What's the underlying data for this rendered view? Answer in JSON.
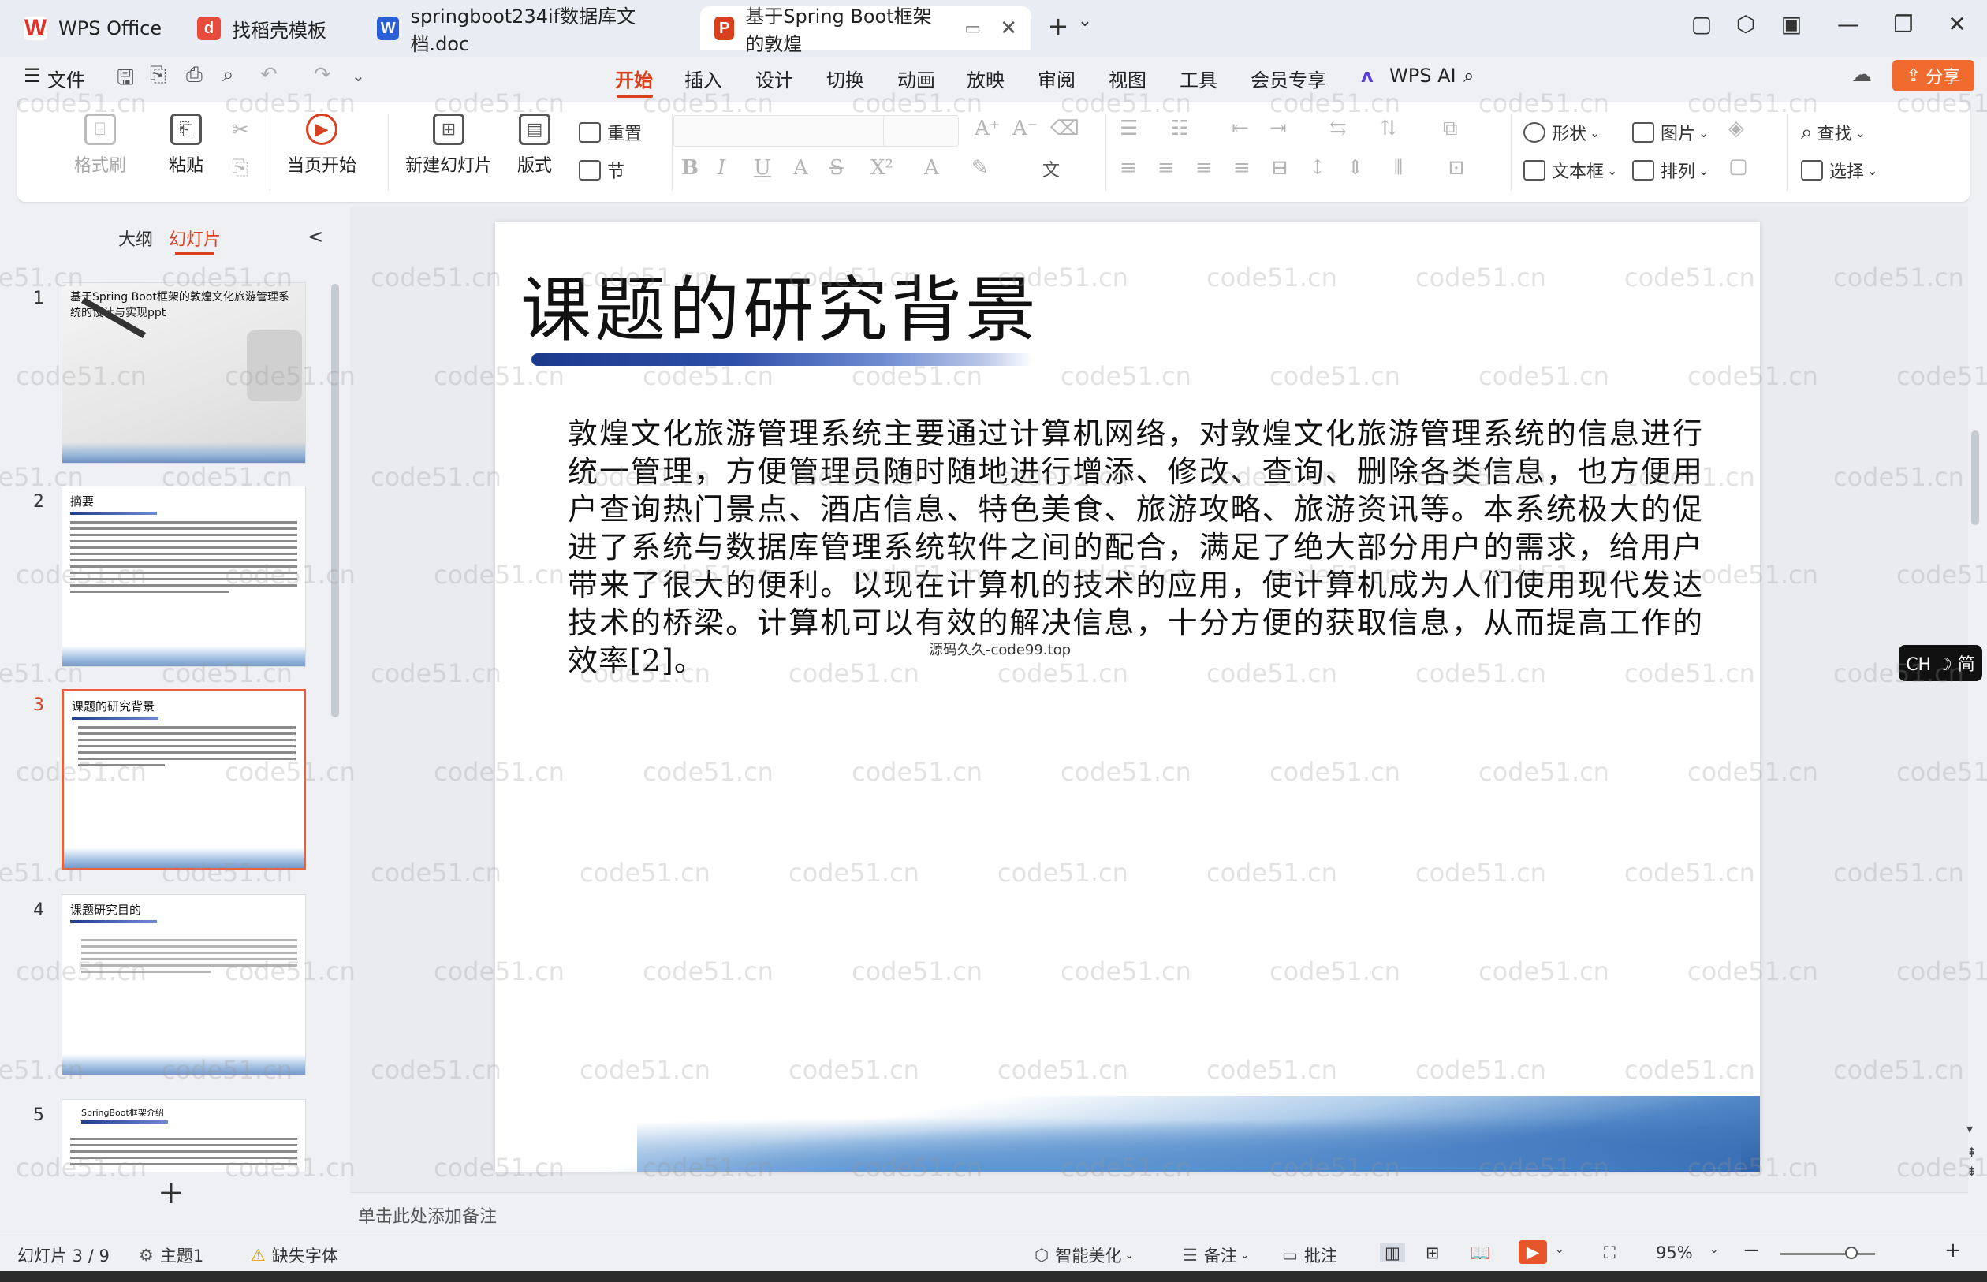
{
  "titlebar": {
    "tabs": [
      {
        "label": "WPS Office",
        "icon": "wps-logo-icon",
        "color": "#e0322b"
      },
      {
        "label": "找稻壳模板",
        "icon": "docer-logo-icon",
        "color": "#e84a3c"
      },
      {
        "label": "springboot234if数据库文档.doc",
        "icon": "word-doc-icon",
        "color": "#2b5fd9"
      },
      {
        "label": "基于Spring Boot框架的敦煌",
        "icon": "ppt-doc-icon",
        "color": "#d9411e"
      }
    ],
    "new_tab": "+",
    "tab_menu": "⌄"
  },
  "menubar": {
    "file": "文件",
    "items": [
      "开始",
      "插入",
      "设计",
      "切换",
      "动画",
      "放映",
      "审阅",
      "视图",
      "工具",
      "会员专享"
    ],
    "wps_ai": "WPS AI",
    "share": "分享"
  },
  "ribbon": {
    "format_painter": "格式刷",
    "paste": "粘贴",
    "play_current": "当页开始",
    "new_slide": "新建幻灯片",
    "layout": "版式",
    "reset": "重置",
    "section": "节",
    "shape": "形状",
    "picture": "图片",
    "textbox": "文本框",
    "arrange": "排列",
    "find": "查找",
    "select": "选择"
  },
  "leftpanel": {
    "tab_outline": "大纲",
    "tab_slides": "幻灯片",
    "collapse": "<",
    "thumbnails": [
      {
        "num": "1",
        "title": "基于Spring Boot框架的敦煌文化旅游管理系统的设计与实现ppt"
      },
      {
        "num": "2",
        "title": "摘要"
      },
      {
        "num": "3",
        "title": "课题的研究背景"
      },
      {
        "num": "4",
        "title": "课题研究目的"
      },
      {
        "num": "5",
        "title": "SpringBoot框架介绍"
      }
    ],
    "add": "+"
  },
  "slide": {
    "title": "课题的研究背景",
    "body": "敦煌文化旅游管理系统主要通过计算机网络，对敦煌文化旅游管理系统的信息进行统一管理，方便管理员随时随地进行增添、修改、查询、删除各类信息，也方便用户查询热门景点、酒店信息、特色美食、旅游攻略、旅游资讯等。本系统极大的促进了系统与数据库管理系统软件之间的配合，满足了绝大部分用户的需求，给用户带来了很大的便利。以现在计算机的技术的应用，使计算机成为人们使用现代发达技术的桥梁。计算机可以有效的解决信息，十分方便的获取信息，从而提高工作的效率[2]。",
    "caption": "源码久久-code99.top"
  },
  "notes": {
    "placeholder": "单击此处添加备注"
  },
  "statusbar": {
    "slide_counter": "幻灯片 3 / 9",
    "theme": "主题1",
    "missing_font": "缺失字体",
    "smart_beautify": "智能美化",
    "notes": "备注",
    "comments": "批注",
    "zoom": "95%"
  },
  "ime": {
    "label": "CH ☽ 简"
  },
  "watermark": {
    "text": "code51.cn"
  },
  "colors": {
    "accent": "#d9411e",
    "share": "#f26b2e"
  }
}
